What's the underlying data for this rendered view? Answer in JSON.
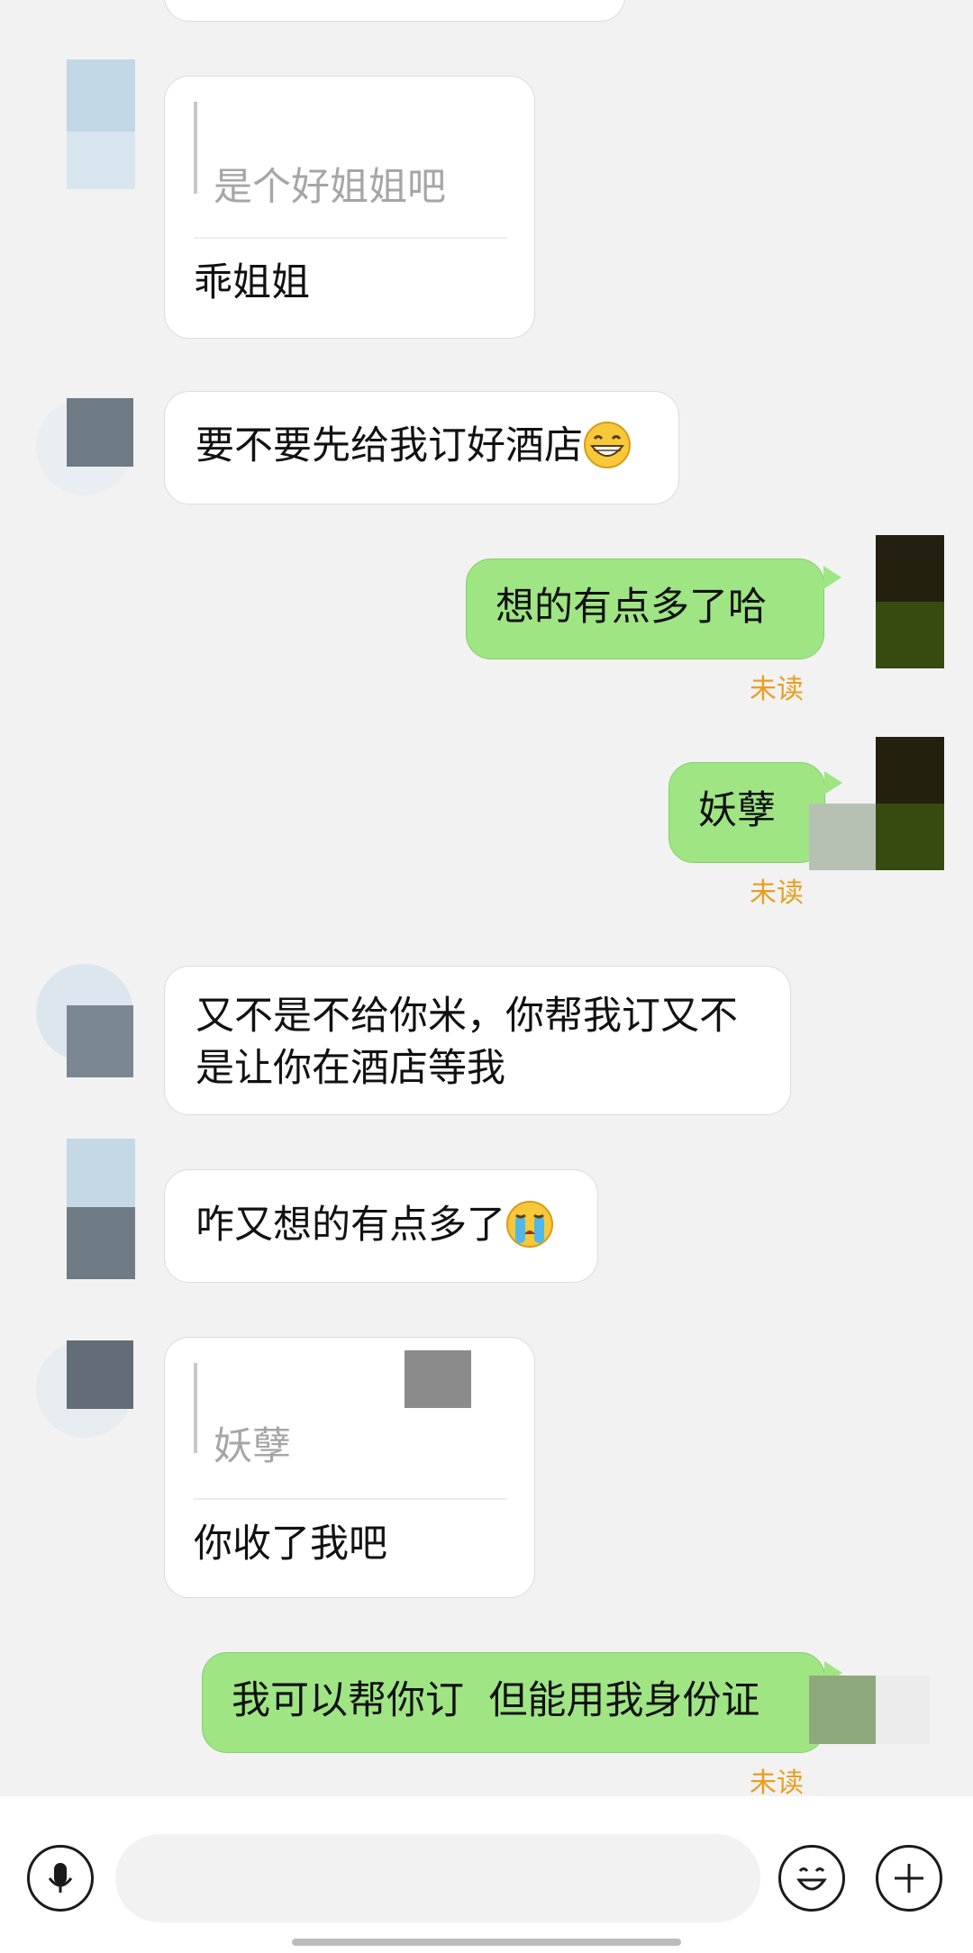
{
  "messages": [
    {
      "side": "in",
      "quote": "是个好姐姐吧",
      "text": "乖姐姐"
    },
    {
      "side": "in",
      "text": "要不要先给我订好酒店",
      "emoji": "grinning-face"
    },
    {
      "side": "out",
      "text": "想的有点多了哈",
      "status": "未读"
    },
    {
      "side": "out",
      "text": "妖孽",
      "status": "未读"
    },
    {
      "side": "in",
      "text_line1": "又不是不给你米，你帮我订又不",
      "text_line2": "是让你在酒店等我"
    },
    {
      "side": "in",
      "text": "咋又想的有点多了",
      "emoji": "crying-face"
    },
    {
      "side": "in",
      "quote": "妖孽",
      "text": "你收了我吧"
    },
    {
      "side": "out",
      "text": "我可以帮你订  但能用我身份证",
      "status": "未读"
    }
  ],
  "input_bar": {
    "placeholder": "",
    "value": "",
    "left_icon": "microphone-icon",
    "emoji_icon": "smiley-icon",
    "plus_icon": "plus-icon"
  },
  "colors": {
    "background": "#f2f2f2",
    "incoming_bubble": "#ffffff",
    "outgoing_bubble": "#9fe584",
    "unread_status": "#e6a020",
    "quote_text": "#a6a6a6"
  }
}
